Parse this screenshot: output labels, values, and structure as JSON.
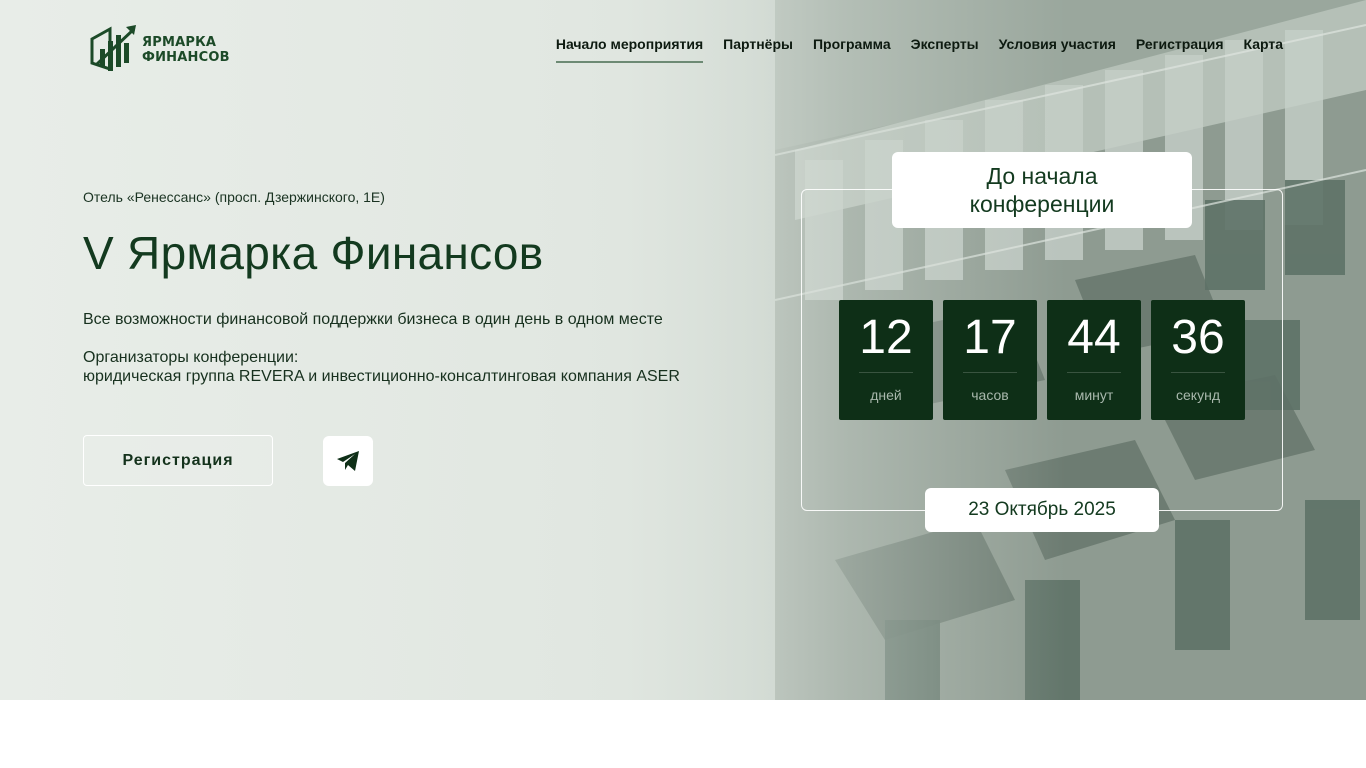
{
  "header": {
    "logo_line1": "ЯРМАРКА",
    "logo_line2": "ФИНАНСОВ",
    "nav": [
      {
        "label": "Начало мероприятия",
        "active": true
      },
      {
        "label": "Партнёры"
      },
      {
        "label": "Программа"
      },
      {
        "label": "Эксперты"
      },
      {
        "label": "Условия участия"
      },
      {
        "label": "Регистрация"
      },
      {
        "label": "Карта"
      }
    ]
  },
  "hero": {
    "venue": "Отель «Ренессанс» (просп. Дзержинского, 1Е)",
    "title": "V Ярмарка Финансов",
    "description": "Все возможности финансовой поддержки бизнеса в один день в одном месте",
    "organizers_label": "Организаторы конференции:",
    "organizers": "юридическая группа REVERA и инвестиционно-консалтинговая компания ASER",
    "register_button": "Регистрация",
    "telegram_icon": "telegram-icon"
  },
  "countdown": {
    "heading": "До начала конференции",
    "units": [
      {
        "value": "12",
        "label": "дней"
      },
      {
        "value": "17",
        "label": "часов"
      },
      {
        "value": "44",
        "label": "минут"
      },
      {
        "value": "36",
        "label": "секунд"
      }
    ],
    "date": "23 Октябрь 2025"
  },
  "colors": {
    "brand_dark_green": "#0e2f17",
    "text_green": "#133a1f",
    "nav_active_underline": "#6d8a74"
  }
}
